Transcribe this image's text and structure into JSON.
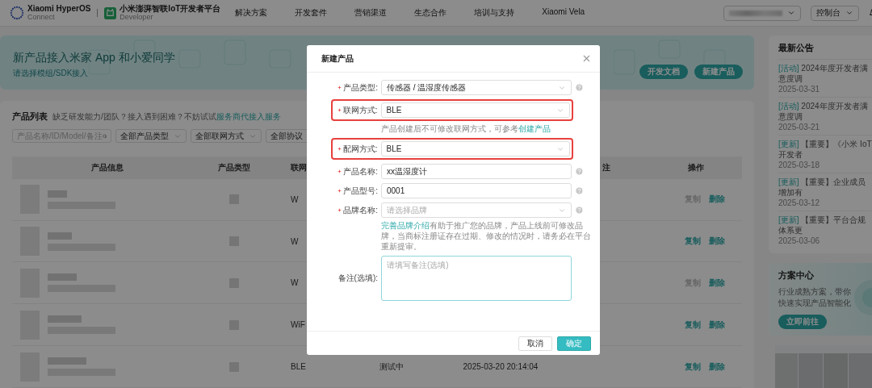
{
  "header": {
    "logo_title": "Xiaomi HyperOS",
    "logo_sub": "Connect",
    "brand_title": "小米澎湃智联IoT开发者平台",
    "brand_sub": "Developer",
    "nav": [
      "解决方案",
      "开发套件",
      "营销渠道",
      "生态合作",
      "培训与支持",
      "Xiaomi Vela"
    ],
    "console": "控制台"
  },
  "banner": {
    "title": "新产品接入米家 App 和小爱同学",
    "subtitle": "请选择模组/SDK接入",
    "buttons": [
      "开发文档",
      "新建产品"
    ]
  },
  "product_list": {
    "title": "产品列表",
    "hint": "缺乏研发能力/团队？接入遇到困难？不妨试试",
    "link": "服务商代接入服务",
    "search_placeholder": "产品名称/ID/Model/备注",
    "selects": [
      "全部产品类型",
      "全部联网方式",
      "全部协议"
    ],
    "columns": [
      "产品信息",
      "产品类型",
      "联网",
      "注",
      "操作"
    ],
    "rows": [
      {
        "connection": "W",
        "actions": [
          {
            "label": "复制",
            "disabled": true
          },
          {
            "label": "删除",
            "disabled": false
          }
        ]
      },
      {
        "connection": "W",
        "actions": [
          {
            "label": "复制",
            "disabled": false
          },
          {
            "label": "删除",
            "disabled": false
          }
        ]
      },
      {
        "connection": "W",
        "actions": [
          {
            "label": "复制",
            "disabled": true
          },
          {
            "label": "删除",
            "disabled": false
          }
        ]
      },
      {
        "connection": "WiF",
        "actions": [
          {
            "label": "复制",
            "disabled": false
          },
          {
            "label": "删除",
            "disabled": false
          }
        ]
      },
      {
        "connection": "BLE",
        "status": "测试中",
        "time": "2025-03-20 20:14:04",
        "actions": [
          {
            "label": "复制",
            "disabled": false
          },
          {
            "label": "删除",
            "disabled": false
          }
        ]
      }
    ]
  },
  "announcements": {
    "title": "最新公告",
    "items": [
      {
        "tag": "[活动]",
        "text": "2024年度开发者满意度调",
        "date": "2025-03-31"
      },
      {
        "tag": "[活动]",
        "text": "2024年度开发者满意度调",
        "date": "2025-03-21"
      },
      {
        "tag": "[更新]",
        "text": "【重要】《小米 IoT 开发者",
        "date": "2025-03-18"
      },
      {
        "tag": "[更新]",
        "text": "【重要】企业成员增加有",
        "date": "2025-03-12"
      },
      {
        "tag": "[更新]",
        "text": "【重要】平台合规体系更",
        "date": "2025-03-06"
      }
    ]
  },
  "solution_center": {
    "title": "方案中心",
    "text": "行业成熟方案，带你快速实现产品智能化",
    "button": "立即前往"
  },
  "dialog": {
    "title": "新建产品",
    "fields": [
      {
        "kind": "select",
        "label": "产品类型:",
        "required": true,
        "value": "传感器 / 温湿度传感器",
        "help": true,
        "highlighted": false
      },
      {
        "kind": "select",
        "label": "联网方式:",
        "required": true,
        "value": "BLE",
        "help": false,
        "highlighted": true,
        "hint": [
          {
            "kind": "text",
            "text": "产品创建后不可修改联网方式，可参考"
          },
          {
            "kind": "link",
            "text": "创建产品"
          }
        ]
      },
      {
        "kind": "select",
        "label": "配网方式:",
        "required": true,
        "value": "BLE",
        "help": false,
        "highlighted": true
      },
      {
        "kind": "input",
        "label": "产品名称:",
        "required": true,
        "value": "xx温湿度计",
        "help": true,
        "highlighted": false
      },
      {
        "kind": "input",
        "label": "产品型号:",
        "required": true,
        "value": "0001",
        "help": true,
        "highlighted": false
      },
      {
        "kind": "select",
        "label": "品牌名称:",
        "required": true,
        "placeholder": "请选择品牌",
        "help": true,
        "highlighted": false,
        "hint": [
          {
            "kind": "link",
            "text": "完善品牌介绍"
          },
          {
            "kind": "text",
            "text": "有助于推广您的品牌，产品上线前可修改品牌，当商标注册证存在过期、修改的情况时，请务必在平台重新提审。"
          }
        ]
      },
      {
        "kind": "textarea",
        "label": "备注(选填):",
        "required": false,
        "placeholder": "请填写备注(选填)",
        "help": false,
        "highlighted": false
      }
    ],
    "buttons": [
      {
        "label": "取消",
        "primary": false
      },
      {
        "label": "确定",
        "primary": true
      }
    ]
  }
}
